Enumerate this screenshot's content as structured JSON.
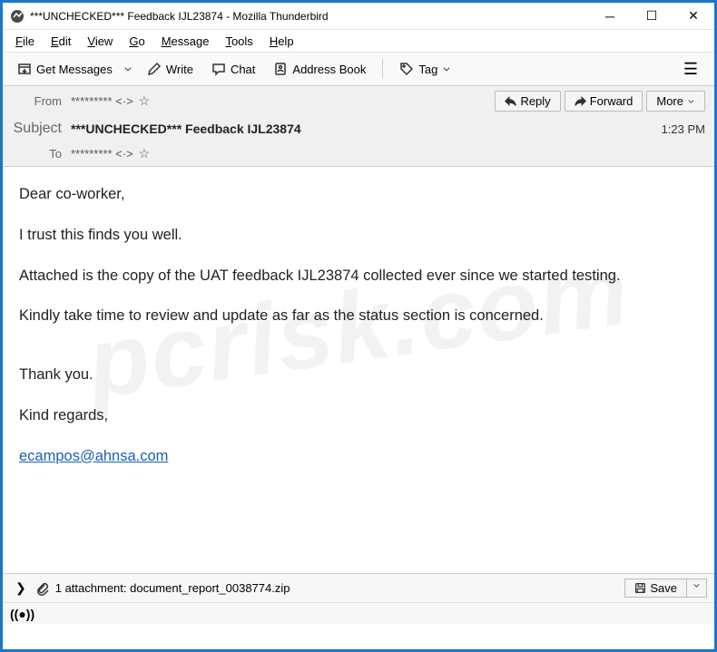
{
  "window": {
    "title": "***UNCHECKED*** Feedback IJL23874 - Mozilla Thunderbird"
  },
  "menu": {
    "file": "File",
    "edit": "Edit",
    "view": "View",
    "go": "Go",
    "message": "Message",
    "tools": "Tools",
    "help": "Help"
  },
  "toolbar": {
    "get_messages": "Get Messages",
    "write": "Write",
    "chat": "Chat",
    "address_book": "Address Book",
    "tag": "Tag"
  },
  "actions": {
    "reply": "Reply",
    "forward": "Forward",
    "more": "More"
  },
  "headers": {
    "from_label": "From",
    "from_value": "********* <·>",
    "subject_label": "Subject",
    "subject_value": "***UNCHECKED*** Feedback IJL23874",
    "to_label": "To",
    "to_value": "********* <·>",
    "time": "1:23 PM"
  },
  "body": {
    "p1": "Dear co-worker,",
    "p2": "I trust this finds you well.",
    "p3": "Attached is the copy of the UAT feedback IJL23874 collected ever since we started testing.",
    "p4": "Kindly take time to review and update as far as the status section is concerned.",
    "p5": "Thank you.",
    "p6": "Kind regards,",
    "email": "ecampos@ahnsa.com"
  },
  "attachment": {
    "text": "1 attachment: document_report_0038774.zip",
    "save": "Save"
  },
  "watermark": "pcrisk.com"
}
